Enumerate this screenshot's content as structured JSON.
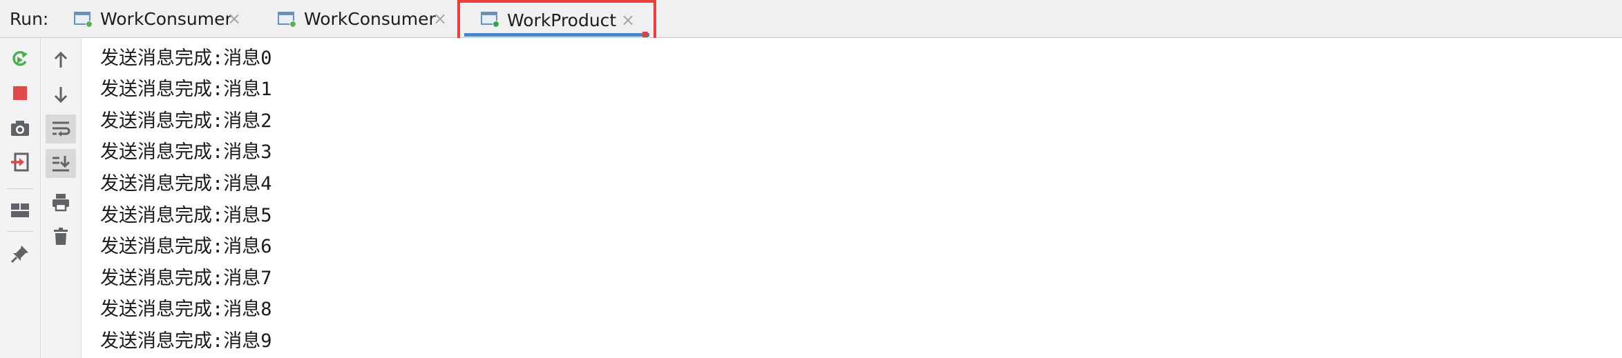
{
  "run_label": "Run:",
  "tabs": [
    {
      "label": "WorkConsumer",
      "close": "×",
      "active": false
    },
    {
      "label": "WorkConsumer",
      "close": "×",
      "active": false
    },
    {
      "label": "WorkProduct",
      "close": "×",
      "active": true
    }
  ],
  "left_toolbar": [
    "rerun-icon",
    "stop-icon",
    "screenshot-camera-icon",
    "restore-layout-icon",
    "layout-icon",
    "pin-icon"
  ],
  "second_toolbar": [
    "scroll-up-icon",
    "scroll-down-icon",
    "soft-wrap-icon",
    "scroll-to-end-icon",
    "print-icon",
    "clear-all-icon"
  ],
  "colors": {
    "accent": "#4a86c7",
    "highlight_border": "#ee3b3b",
    "rerun_green": "#4caf50",
    "stop_red": "#e0484a"
  },
  "console": {
    "lines": [
      "发送消息完成:消息0",
      "发送消息完成:消息1",
      "发送消息完成:消息2",
      "发送消息完成:消息3",
      "发送消息完成:消息4",
      "发送消息完成:消息5",
      "发送消息完成:消息6",
      "发送消息完成:消息7",
      "发送消息完成:消息8",
      "发送消息完成:消息9"
    ]
  }
}
